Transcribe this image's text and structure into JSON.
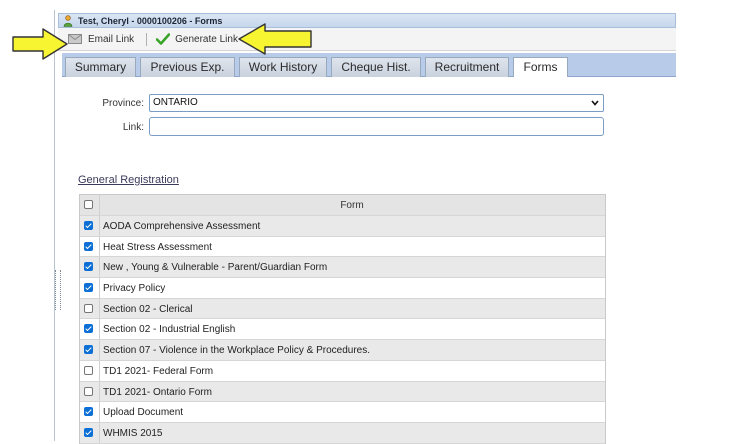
{
  "window": {
    "title": "Test, Cheryl - 0000100206 - Forms"
  },
  "toolbar": {
    "email_label": "Email Link",
    "generate_label": "Generate Link"
  },
  "tabs": [
    {
      "label": "Summary",
      "active": false
    },
    {
      "label": "Previous Exp.",
      "active": false
    },
    {
      "label": "Work History",
      "active": false
    },
    {
      "label": "Cheque Hist.",
      "active": false
    },
    {
      "label": "Recruitment",
      "active": false
    },
    {
      "label": "Forms",
      "active": true
    }
  ],
  "form": {
    "province_label": "Province:",
    "province_value": "ONTARIO",
    "link_label": "Link:",
    "link_value": ""
  },
  "section": {
    "title": "General Registration",
    "column_header": "Form",
    "header_checked": false,
    "rows": [
      {
        "label": "AODA Comprehensive Assessment",
        "checked": true
      },
      {
        "label": "Heat Stress Assessment",
        "checked": true
      },
      {
        "label": "New , Young & Vulnerable - Parent/Guardian Form",
        "checked": true
      },
      {
        "label": "Privacy Policy",
        "checked": true
      },
      {
        "label": "Section 02 - Clerical",
        "checked": false
      },
      {
        "label": "Section 02 - Industrial English",
        "checked": true
      },
      {
        "label": "Section 07 - Violence in the Workplace Policy & Procedures.",
        "checked": true
      },
      {
        "label": "TD1 2021- Federal Form",
        "checked": false
      },
      {
        "label": "TD1 2021- Ontario Form",
        "checked": false
      },
      {
        "label": "Upload Document",
        "checked": true
      },
      {
        "label": "WHMIS 2015",
        "checked": true
      }
    ]
  },
  "colors": {
    "arrow_fill": "#f7f531",
    "arrow_stroke": "#333333",
    "checkbox_checked": "#0b6fd6",
    "tabstrip": "#b8cbe8"
  },
  "icons": {
    "window": "person-icon",
    "email": "envelope-icon",
    "generate": "checkmark-icon",
    "select": "chevron-down-icon"
  }
}
